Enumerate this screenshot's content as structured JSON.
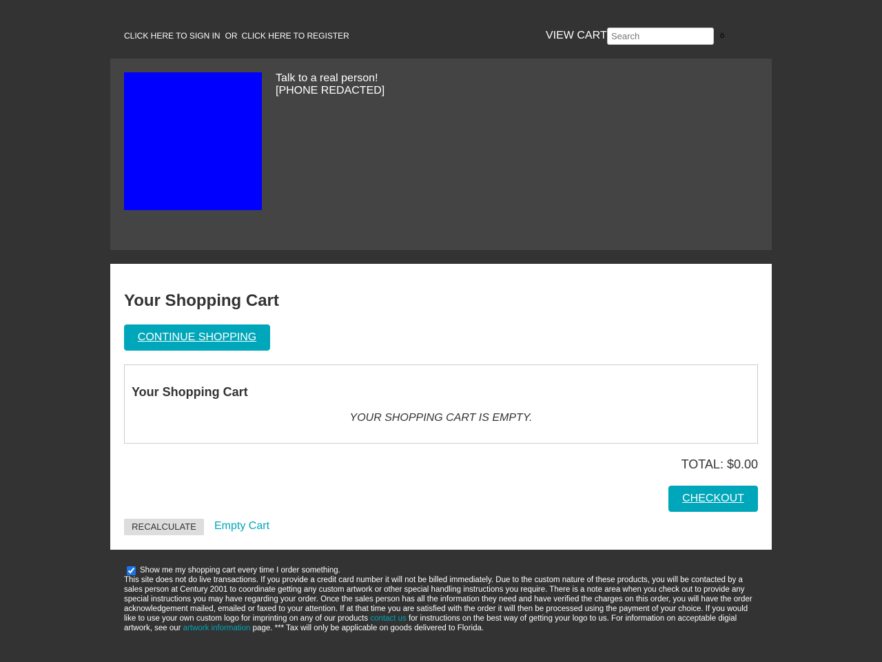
{
  "topbar": {
    "sign_in_link": "CLICK HERE TO SIGN IN",
    "or_text": "OR",
    "register_link": "CLICK HERE TO REGISTER",
    "view_cart_link": "VIEW CART",
    "search_placeholder": "Search",
    "search_button": "ö"
  },
  "header": {
    "logo_color": "#0000ff",
    "contact_line1": "Talk to a real person!",
    "contact_line2": "[PHONE REDACTED]"
  },
  "main": {
    "title": "Your Shopping Cart",
    "continue_button": "CONTINUE SHOPPING",
    "cart_box_title": "Your Shopping Cart",
    "empty_message": "YOUR SHOPPING CART IS EMPTY.",
    "total": "TOTAL: $0.00",
    "checkout_button": "CHECKOUT",
    "recalculate_button": "RECALCULATE",
    "empty_cart_link": "Empty Cart"
  },
  "footer": {
    "checkbox_checked": true,
    "checkbox_label": "Show me my shopping cart every time I order something.",
    "notice_part1": "This site does not do live transactions. If you provide a credit card number it will not be billed immediately. Due to the custom nature of these products, you will be contacted by a sales person at Century 2001 to coordinate getting any custom artwork or other special handling instructions you require. There is a note area when you check out to provide any special instructions you may have regarding your order. Once the sales person has all the information they need and have verified the charges on this order, you will have the order acknowledgement mailed, emailed or faxed to your attention. If at that time you are satisfied with the order it will then be processed using the payment of your choice. If you would like to use your own custom logo for imprinting on any of our products ",
    "contact_link": "contact us",
    "notice_part2": " for instructions on the best way of getting your logo to us. For information on acceptable digial artwork, see our ",
    "artwork_link": "artwork information",
    "notice_part3": " page. *** Tax will only be applicable on goods delivered to Florida."
  },
  "colors": {
    "page_bg": "#333333",
    "header_bg": "#444444",
    "accent": "#00a6b9"
  }
}
